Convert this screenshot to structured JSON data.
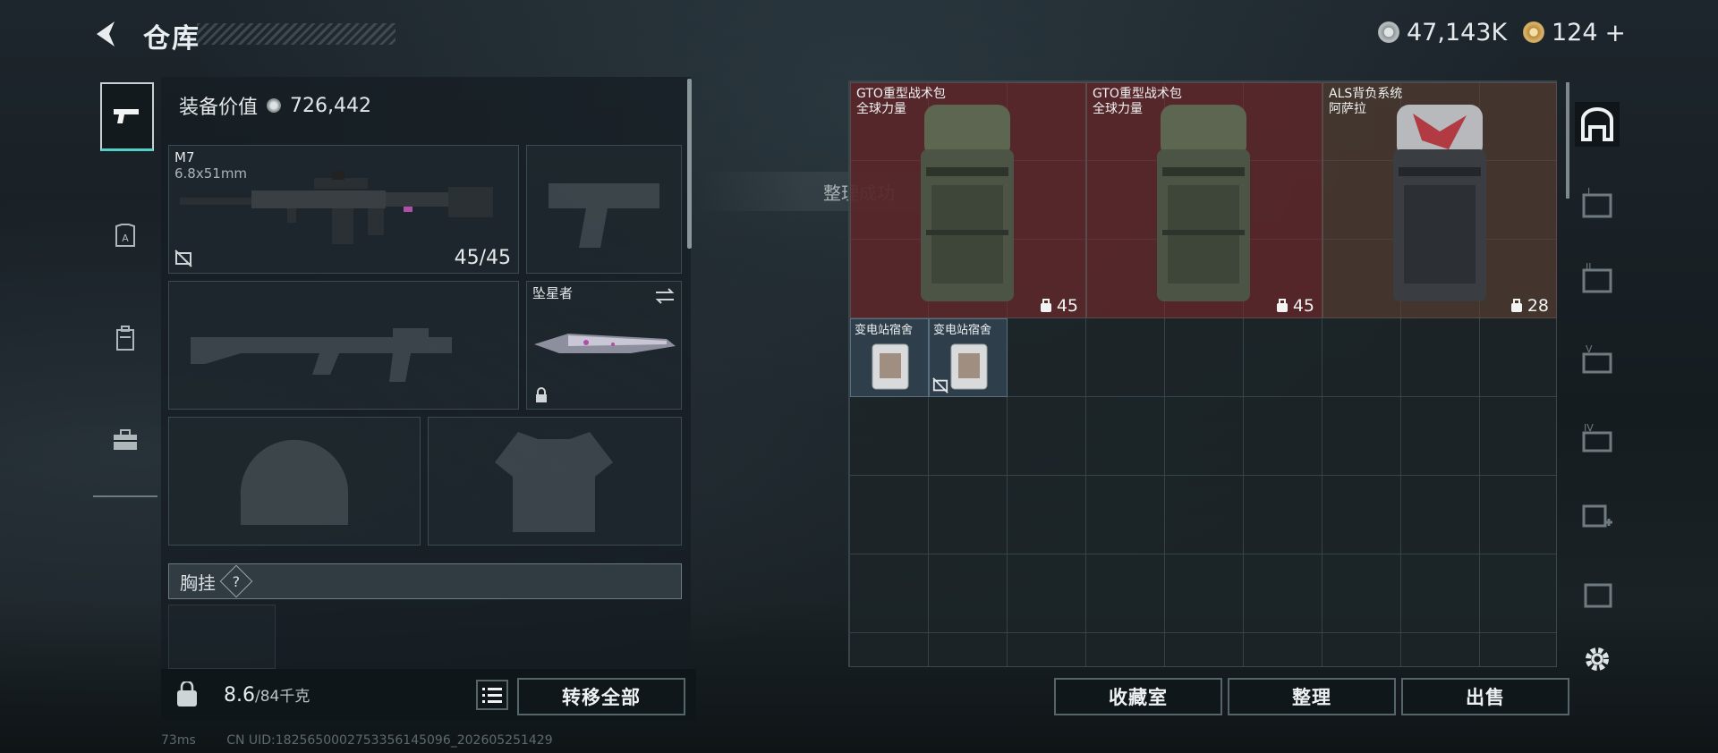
{
  "header": {
    "title": "仓库"
  },
  "currency": {
    "silver": "47,143K",
    "gold": "124",
    "gold_plus": "+"
  },
  "loadout": {
    "value_label": "装备价值",
    "value": "726,442",
    "primary": {
      "name": "M7",
      "caliber": "6.8x51mm",
      "ammo": "45/45"
    },
    "melee": {
      "name": "坠星者"
    },
    "chest_rig_label": "胸挂",
    "help": "?"
  },
  "toast": "整理成功",
  "weight": {
    "current": "8.6",
    "max": "/84千克"
  },
  "buttons": {
    "transfer_all": "转移全部",
    "collection": "收藏室",
    "organize": "整理",
    "sell": "出售"
  },
  "storage": {
    "backpacks": [
      {
        "name": "GTO重型战术包",
        "brand": "全球力量",
        "capacity": "45",
        "color": "red"
      },
      {
        "name": "GTO重型战术包",
        "brand": "全球力量",
        "capacity": "45",
        "color": "red"
      },
      {
        "name": "ALS背负系统",
        "brand": "阿萨拉",
        "capacity": "28",
        "color": "brown"
      }
    ],
    "keycards": [
      {
        "name": "变电站宿舍"
      },
      {
        "name": "变电站宿舍"
      }
    ]
  },
  "rightbar": {
    "tabs": [
      "I",
      "II",
      "V",
      "IV"
    ]
  },
  "footer": {
    "ping": "73ms",
    "uid": "CN UID:1825650002753356145096_202605251429"
  },
  "colors": {
    "accent": "#4fd1c5",
    "red_slot": "#782c2c",
    "brown_slot": "#5c4032"
  }
}
